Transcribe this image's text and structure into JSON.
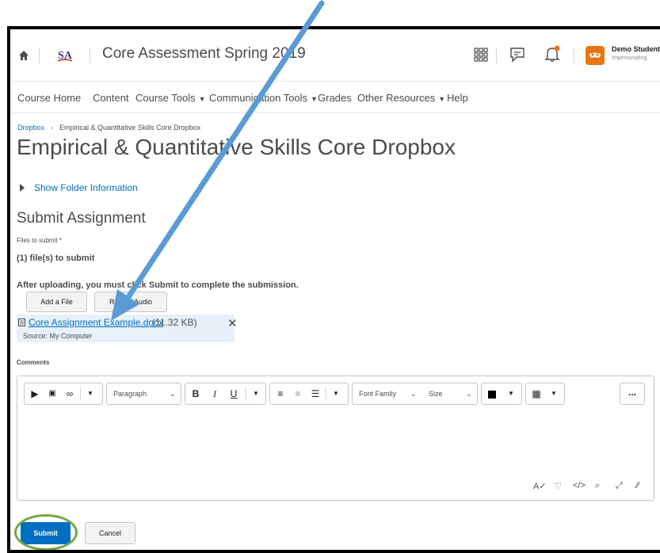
{
  "header": {
    "course_title": "Core Assessment Spring 2019",
    "user_name": "Demo Student",
    "user_status": "Impersonating",
    "logo_text": "SA"
  },
  "nav": {
    "items": [
      {
        "label": "Course Home",
        "has_menu": false
      },
      {
        "label": "Content",
        "has_menu": false
      },
      {
        "label": "Course Tools",
        "has_menu": true
      },
      {
        "label": "Communication Tools",
        "has_menu": true
      },
      {
        "label": "Grades",
        "has_menu": false
      },
      {
        "label": "Other Resources",
        "has_menu": true
      },
      {
        "label": "Help",
        "has_menu": false
      }
    ]
  },
  "breadcrumb": {
    "root": "Dropbox",
    "current": "Empirical & Quantitative Skills Core Dropbox"
  },
  "page": {
    "title": "Empirical & Quantitative Skills Core Dropbox",
    "folder_info_label": "Show Folder Information",
    "section_title": "Submit Assignment",
    "files_label": "Files to submit *",
    "files_count": "(1) file(s) to submit",
    "upload_note": "After uploading, you must click Submit to complete the submission."
  },
  "upload": {
    "add_file_label": "Add a File",
    "record_audio_label": "Record Audio",
    "file_name": "Core Assignment Example.docx",
    "file_size": "(11.32 KB)",
    "file_source": "Source: My Computer"
  },
  "comments": {
    "label": "Comments",
    "paragraph_label": "Paragraph",
    "font_family_label": "Font Family",
    "size_label": "Size",
    "more_label": "..."
  },
  "actions": {
    "submit_label": "Submit",
    "cancel_label": "Cancel"
  },
  "colors": {
    "link": "#006fbf",
    "primary_button": "#006fbf",
    "annotation_arrow": "#5b9bd5",
    "annotation_ring": "#74a646",
    "user_avatar": "#e87511"
  }
}
